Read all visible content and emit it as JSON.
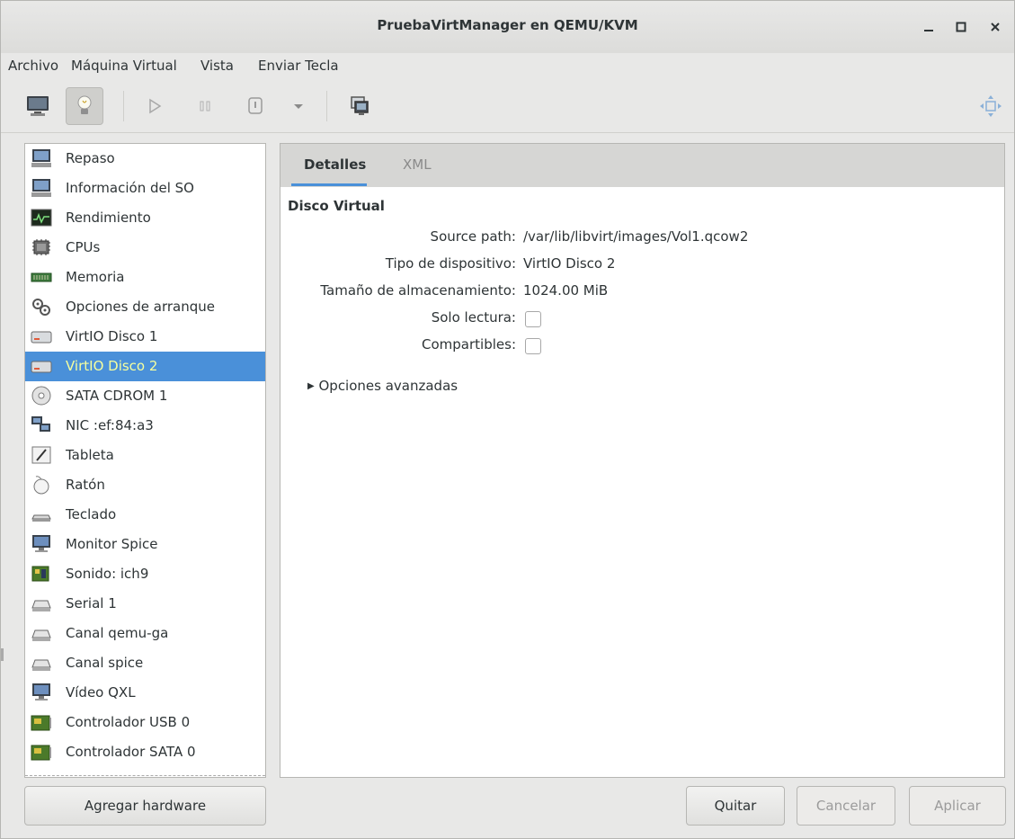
{
  "window": {
    "title": "PruebaVirtManager en QEMU/KVM"
  },
  "menu": [
    "Archivo",
    "Máquina Virtual",
    "Vista",
    "Enviar Tecla"
  ],
  "toolbar": {
    "icons": [
      "monitor-icon",
      "lightbulb-icon",
      "play-icon",
      "pause-icon",
      "power-icon",
      "dropdown-arrow-icon",
      "screenshot-icon",
      "fullscreen-move-icon"
    ]
  },
  "sidebar": {
    "selected_index": 7,
    "items": [
      {
        "label": "Repaso",
        "icon": "computer-icon"
      },
      {
        "label": "Información del SO",
        "icon": "computer-icon"
      },
      {
        "label": "Rendimiento",
        "icon": "performance-graph-icon"
      },
      {
        "label": "CPUs",
        "icon": "cpu-chip-icon"
      },
      {
        "label": "Memoria",
        "icon": "memory-stick-icon"
      },
      {
        "label": "Opciones de arranque",
        "icon": "gears-icon"
      },
      {
        "label": "VirtIO Disco 1",
        "icon": "hard-disk-icon"
      },
      {
        "label": "VirtIO Disco 2",
        "icon": "hard-disk-icon"
      },
      {
        "label": "SATA CDROM 1",
        "icon": "cdrom-icon"
      },
      {
        "label": "NIC :ef:84:a3",
        "icon": "network-icon"
      },
      {
        "label": "Tableta",
        "icon": "tablet-icon"
      },
      {
        "label": "Ratón",
        "icon": "mouse-icon"
      },
      {
        "label": "Teclado",
        "icon": "keyboard-icon"
      },
      {
        "label": "Monitor Spice",
        "icon": "display-icon"
      },
      {
        "label": "Sonido: ich9",
        "icon": "sound-card-icon"
      },
      {
        "label": "Serial 1",
        "icon": "serial-port-icon"
      },
      {
        "label": "Canal qemu-ga",
        "icon": "channel-icon"
      },
      {
        "label": "Canal spice",
        "icon": "channel-icon"
      },
      {
        "label": "Vídeo QXL",
        "icon": "display-icon"
      },
      {
        "label": "Controlador USB 0",
        "icon": "controller-card-icon"
      },
      {
        "label": "Controlador SATA 0",
        "icon": "controller-card-icon"
      }
    ]
  },
  "tabs": [
    {
      "label": "Detalles",
      "active": true
    },
    {
      "label": "XML",
      "active": false
    }
  ],
  "details": {
    "section_title": "Disco Virtual",
    "source_path_label": "Source path:",
    "source_path_value": "/var/lib/libvirt/images/Vol1.qcow2",
    "device_type_label": "Tipo de dispositivo:",
    "device_type_value": "VirtIO Disco 2",
    "storage_size_label": "Tamaño de almacenamiento:",
    "storage_size_value": "1024.00 MiB",
    "readonly_label": "Solo lectura:",
    "readonly_checked": false,
    "shareable_label": "Compartibles:",
    "shareable_checked": false,
    "advanced_label": "Opciones avanzadas"
  },
  "buttons": {
    "add_hardware": "Agregar hardware",
    "remove": "Quitar",
    "cancel": "Cancelar",
    "apply": "Aplicar"
  },
  "colors": {
    "selection": "#4a90d9",
    "selection_text": "#f6ff9e"
  }
}
